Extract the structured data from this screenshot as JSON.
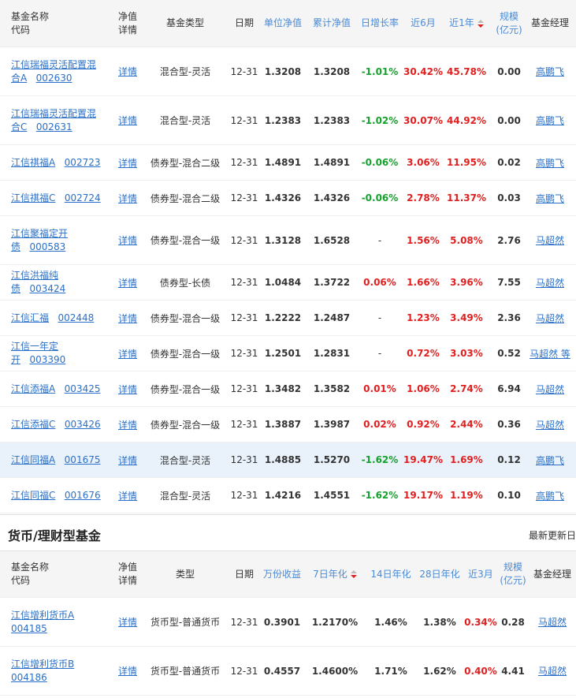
{
  "table1": {
    "headers": {
      "name": "基金名称\n代码",
      "detail": "净值\n详情",
      "type": "基金类型",
      "date": "日期",
      "nav": "单位净值",
      "acc": "累计净值",
      "daily": "日增长率",
      "m6": "近6月",
      "y1": "近1年",
      "scale": "规模\n(亿元)",
      "manager": "基金经理"
    },
    "rows": [
      {
        "name": "江信瑞福灵活配置混合A",
        "code": "002630",
        "detail": "详情",
        "type": "混合型-灵活",
        "date": "12-31",
        "nav": "1.3208",
        "acc": "1.3208",
        "daily": "-1.01%",
        "m6": "30.42%",
        "y1": "45.78%",
        "scale": "0.00",
        "manager": "高鹏飞"
      },
      {
        "name": "江信瑞福灵活配置混合C",
        "code": "002631",
        "detail": "详情",
        "type": "混合型-灵活",
        "date": "12-31",
        "nav": "1.2383",
        "acc": "1.2383",
        "daily": "-1.02%",
        "m6": "30.07%",
        "y1": "44.92%",
        "scale": "0.00",
        "manager": "高鹏飞"
      },
      {
        "name": "江信祺福A",
        "code": "002723",
        "detail": "详情",
        "type": "债券型-混合二级",
        "date": "12-31",
        "nav": "1.4891",
        "acc": "1.4891",
        "daily": "-0.06%",
        "m6": "3.06%",
        "y1": "11.95%",
        "scale": "0.02",
        "manager": "高鹏飞"
      },
      {
        "name": "江信祺福C",
        "code": "002724",
        "detail": "详情",
        "type": "债券型-混合二级",
        "date": "12-31",
        "nav": "1.4326",
        "acc": "1.4326",
        "daily": "-0.06%",
        "m6": "2.78%",
        "y1": "11.37%",
        "scale": "0.03",
        "manager": "高鹏飞"
      },
      {
        "name": "江信聚福定开债",
        "code": "000583",
        "detail": "详情",
        "type": "债券型-混合一级",
        "date": "12-31",
        "nav": "1.3128",
        "acc": "1.6528",
        "daily": "-",
        "m6": "1.56%",
        "y1": "5.08%",
        "scale": "2.76",
        "manager": "马超然"
      },
      {
        "name": "江信洪福纯债",
        "code": "003424",
        "detail": "详情",
        "type": "债券型-长债",
        "date": "12-31",
        "nav": "1.0484",
        "acc": "1.3722",
        "daily": "0.06%",
        "m6": "1.66%",
        "y1": "3.96%",
        "scale": "7.55",
        "manager": "马超然"
      },
      {
        "name": "江信汇福",
        "code": "002448",
        "detail": "详情",
        "type": "债券型-混合一级",
        "date": "12-31",
        "nav": "1.2222",
        "acc": "1.2487",
        "daily": "-",
        "m6": "1.23%",
        "y1": "3.49%",
        "scale": "2.36",
        "manager": "马超然"
      },
      {
        "name": "江信一年定开",
        "code": "003390",
        "detail": "详情",
        "type": "债券型-混合一级",
        "date": "12-31",
        "nav": "1.2501",
        "acc": "1.2831",
        "daily": "-",
        "m6": "0.72%",
        "y1": "3.03%",
        "scale": "0.52",
        "manager": "马超然 等"
      },
      {
        "name": "江信添福A",
        "code": "003425",
        "detail": "详情",
        "type": "债券型-混合一级",
        "date": "12-31",
        "nav": "1.3482",
        "acc": "1.3582",
        "daily": "0.01%",
        "m6": "1.06%",
        "y1": "2.74%",
        "scale": "6.94",
        "manager": "马超然"
      },
      {
        "name": "江信添福C",
        "code": "003426",
        "detail": "详情",
        "type": "债券型-混合一级",
        "date": "12-31",
        "nav": "1.3887",
        "acc": "1.3987",
        "daily": "0.02%",
        "m6": "0.92%",
        "y1": "2.44%",
        "scale": "0.36",
        "manager": "马超然"
      },
      {
        "name": "江信同福A",
        "code": "001675",
        "detail": "详情",
        "type": "混合型-灵活",
        "date": "12-31",
        "nav": "1.4885",
        "acc": "1.5270",
        "daily": "-1.62%",
        "m6": "19.47%",
        "y1": "1.69%",
        "scale": "0.12",
        "manager": "高鹏飞"
      },
      {
        "name": "江信同福C",
        "code": "001676",
        "detail": "详情",
        "type": "混合型-灵活",
        "date": "12-31",
        "nav": "1.4216",
        "acc": "1.4551",
        "daily": "-1.62%",
        "m6": "19.17%",
        "y1": "1.19%",
        "scale": "0.10",
        "manager": "高鹏飞"
      }
    ]
  },
  "section2": {
    "title": "货币/理财型基金",
    "updated": "最新更新日"
  },
  "table2": {
    "headers": {
      "name": "基金名称\n代码",
      "detail": "净值\n详情",
      "type": "类型",
      "date": "日期",
      "wan": "万份收益",
      "d7": "7日年化",
      "d14": "14日年化",
      "d28": "28日年化",
      "m3": "近3月",
      "scale": "规模\n(亿元)",
      "manager": "基金经理"
    },
    "rows": [
      {
        "name": "江信增利货币A",
        "code": "004185",
        "detail": "详情",
        "type": "货币型-普通货币",
        "date": "12-31",
        "wan": "0.3901",
        "d7": "1.2170%",
        "d14": "1.46%",
        "d28": "1.38%",
        "m3": "0.34%",
        "scale": "0.28",
        "manager": "马超然"
      },
      {
        "name": "江信增利货币B",
        "code": "004186",
        "detail": "详情",
        "type": "货币型-普通货币",
        "date": "12-31",
        "wan": "0.4557",
        "d7": "1.4600%",
        "d14": "1.71%",
        "d28": "1.62%",
        "m3": "0.40%",
        "scale": "4.41",
        "manager": "马超然"
      }
    ]
  },
  "colors": {
    "link": "#2a70c9",
    "up": "#e02020",
    "down": "#16a02c",
    "header_bg": "#f5f5f5",
    "highlight": "#e9f2fb"
  }
}
